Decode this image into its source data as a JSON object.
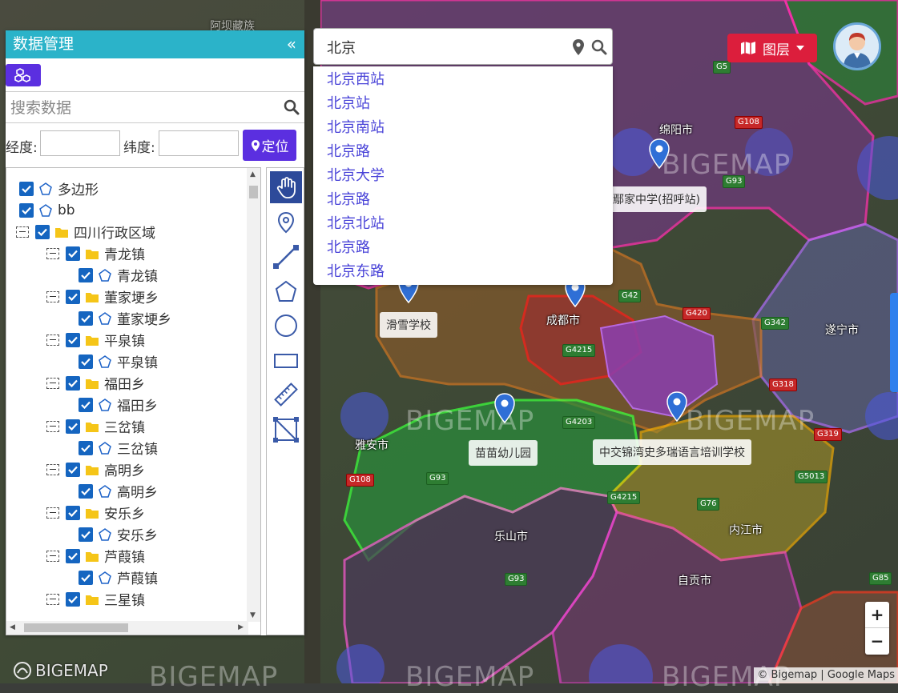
{
  "panel": {
    "title": "数据管理",
    "collapse_symbol": "«",
    "search_placeholder": "搜索数据",
    "lng_label": "经度:",
    "lat_label": "纬度:",
    "locate_label": "定位",
    "tree": [
      {
        "label": "多边形",
        "type": "polygon",
        "level": 0
      },
      {
        "label": "bb",
        "type": "polygon",
        "level": 0
      },
      {
        "label": "四川行政区域",
        "type": "folder",
        "level": 0
      },
      {
        "label": "青龙镇",
        "type": "folder",
        "level": 1
      },
      {
        "label": "青龙镇",
        "type": "polygon",
        "level": 2
      },
      {
        "label": "董家埂乡",
        "type": "folder",
        "level": 1
      },
      {
        "label": "董家埂乡",
        "type": "polygon",
        "level": 2
      },
      {
        "label": "平泉镇",
        "type": "folder",
        "level": 1
      },
      {
        "label": "平泉镇",
        "type": "polygon",
        "level": 2
      },
      {
        "label": "福田乡",
        "type": "folder",
        "level": 1
      },
      {
        "label": "福田乡",
        "type": "polygon",
        "level": 2
      },
      {
        "label": "三岔镇",
        "type": "folder",
        "level": 1
      },
      {
        "label": "三岔镇",
        "type": "polygon",
        "level": 2
      },
      {
        "label": "高明乡",
        "type": "folder",
        "level": 1
      },
      {
        "label": "高明乡",
        "type": "polygon",
        "level": 2
      },
      {
        "label": "安乐乡",
        "type": "folder",
        "level": 1
      },
      {
        "label": "安乐乡",
        "type": "polygon",
        "level": 2
      },
      {
        "label": "芦葭镇",
        "type": "folder",
        "level": 1
      },
      {
        "label": "芦葭镇",
        "type": "polygon",
        "level": 2
      },
      {
        "label": "三星镇",
        "type": "folder",
        "level": 1
      }
    ],
    "tools": [
      "hand-icon",
      "marker-icon",
      "line-icon",
      "polygon-icon",
      "circle-icon",
      "rectangle-icon",
      "ruler-icon",
      "crop-icon"
    ]
  },
  "map_search": {
    "value": "北京",
    "suggestions": [
      "北京西站",
      "北京站",
      "北京南站",
      "北京路",
      "北京大学",
      "北京路",
      "北京北站",
      "北京路",
      "北京东路"
    ]
  },
  "layer_button": {
    "label": "图层"
  },
  "map": {
    "places": [
      {
        "name": "绵阳市"
      },
      {
        "name": "遂宁市"
      },
      {
        "name": "雅安市"
      },
      {
        "name": "乐山市"
      },
      {
        "name": "内江市"
      },
      {
        "name": "自贡市"
      },
      {
        "name": "成都市"
      },
      {
        "name": "阿坝藏族"
      }
    ],
    "poi": [
      {
        "name": "鄢家中学(招呼站)"
      },
      {
        "name": "滑雪学校"
      },
      {
        "name": "苗苗幼儿园"
      },
      {
        "name": "中交锦湾史多瑞语言培训学校"
      }
    ],
    "roads": [
      "G5",
      "G108",
      "G93",
      "G42",
      "G420",
      "G4215",
      "G318",
      "G319",
      "G5013",
      "G76",
      "G4203",
      "G85",
      "G342"
    ],
    "watermark": "BIGEMAP",
    "attribution": "© Bigemap | Google Maps",
    "logo_text": "BIGEMAP"
  },
  "zoom": {
    "in": "+",
    "out": "−"
  },
  "colors": {
    "panel_header": "#2bb3c9",
    "primary": "#5b2fe0",
    "layer_button": "#dc1e3c",
    "checkbox": "#1565c0"
  }
}
